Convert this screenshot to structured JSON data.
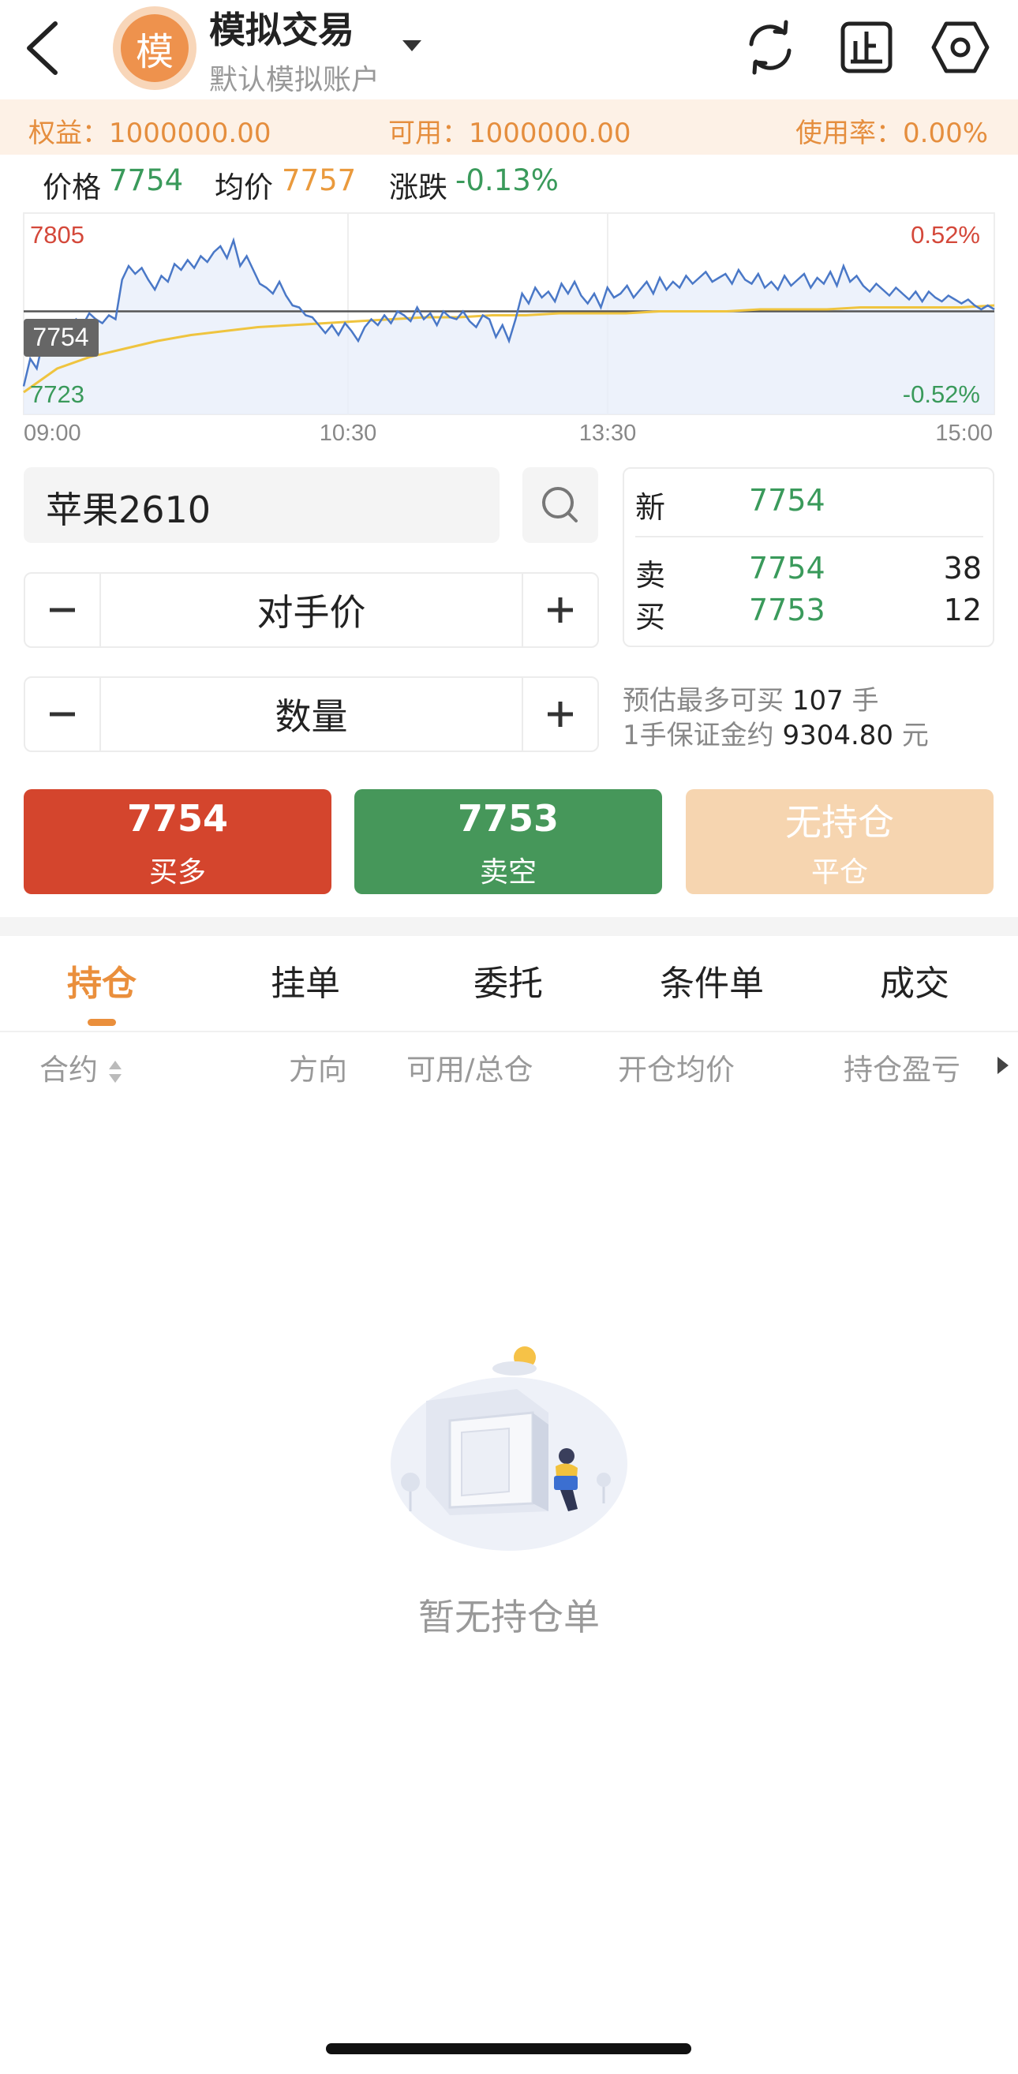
{
  "header": {
    "title": "模拟交易",
    "subtitle": "默认模拟账户",
    "avatar_char": "模",
    "icons": [
      "back-icon",
      "refresh-icon",
      "stop-order-icon",
      "settings-icon"
    ]
  },
  "account": {
    "equity_label": "权益：",
    "equity_value": "1000000.00",
    "available_label": "可用：",
    "available_value": "1000000.00",
    "usage_label": "使用率：",
    "usage_value": "0.00%"
  },
  "price_row": {
    "price_label": "价格",
    "price_value": "7754",
    "avg_label": "均价",
    "avg_value": "7757",
    "change_label": "涨跌",
    "change_value": "-0.13%"
  },
  "chart_data": {
    "type": "line",
    "y_top_label": "7805",
    "y_bottom_label": "7723",
    "pct_top_label": "0.52%",
    "pct_bottom_label": "-0.52%",
    "current_tag": "7754",
    "x_ticks": [
      "09:00",
      "10:30",
      "13:30",
      "15:00"
    ],
    "ylim": [
      7723,
      7805
    ],
    "baseline": 7764,
    "series": [
      {
        "values": [
          7726,
          7740,
          7735,
          7750,
          7745,
          7752,
          7748,
          7755,
          7760,
          7757,
          7763,
          7760,
          7758,
          7762,
          7760,
          7780,
          7787,
          7783,
          7786,
          7780,
          7775,
          7782,
          7779,
          7788,
          7785,
          7790,
          7786,
          7792,
          7789,
          7794,
          7797,
          7791,
          7800,
          7787,
          7792,
          7785,
          7778,
          7776,
          7773,
          7779,
          7772,
          7767,
          7766,
          7762,
          7761,
          7757,
          7753,
          7757,
          7752,
          7758,
          7754,
          7749,
          7756,
          7760,
          7757,
          7762,
          7758,
          7764,
          7762,
          7759,
          7766,
          7760,
          7763,
          7757,
          7764,
          7761,
          7760,
          7764,
          7759,
          7756,
          7762,
          7760,
          7751,
          7757,
          7749,
          7760,
          7773,
          7768,
          7776,
          7771,
          7774,
          7769,
          7778,
          7773,
          7779,
          7772,
          7768,
          7773,
          7766,
          7776,
          7771,
          7773,
          7777,
          7771,
          7775,
          7779,
          7773,
          7781,
          7775,
          7779,
          7776,
          7782,
          7778,
          7781,
          7784,
          7779,
          7781,
          7783,
          7778,
          7785,
          7780,
          7778,
          7783,
          7776,
          7779,
          7775,
          7782,
          7777,
          7780,
          7783,
          7776,
          7781,
          7778,
          7784,
          7777,
          7787,
          7779,
          7782,
          7777,
          7774,
          7778,
          7775,
          7772,
          7776,
          7773,
          7770,
          7774,
          7769,
          7774,
          7771,
          7769,
          7772,
          7770,
          7768,
          7770,
          7767,
          7765,
          7767,
          7765
        ]
      },
      {
        "name": "均价",
        "values": [
          7723,
          7735,
          7741,
          7745,
          7749,
          7752,
          7754,
          7756,
          7757,
          7758,
          7759,
          7760,
          7761,
          7761,
          7762,
          7762,
          7763,
          7763,
          7763,
          7764,
          7764,
          7764,
          7765,
          7765,
          7765,
          7766,
          7766,
          7766,
          7766,
          7767
        ]
      }
    ]
  },
  "order": {
    "contract": "苹果2610",
    "price_mode": "对手价",
    "quantity_label": "数量",
    "est_text": "预估最多可买",
    "est_count": "107",
    "est_unit": "手",
    "margin_text": "1手保证金约",
    "margin_value": "9304.80",
    "margin_unit": "元"
  },
  "quote": {
    "new_label": "新",
    "new_price": "7754",
    "ask_label": "卖",
    "ask_price": "7754",
    "ask_vol": "38",
    "bid_label": "买",
    "bid_price": "7753",
    "bid_vol": "12"
  },
  "actions": {
    "buy_price": "7754",
    "buy_label": "买多",
    "sell_price": "7753",
    "sell_label": "卖空",
    "close_status": "无持仓",
    "close_label": "平仓"
  },
  "tabs": [
    "持仓",
    "挂单",
    "委托",
    "条件单",
    "成交"
  ],
  "columns": [
    "合约",
    "方向",
    "可用/总仓",
    "开仓均价",
    "持仓盈亏"
  ],
  "empty_text": "暂无持仓单",
  "colors": {
    "accent": "#ea8f3c",
    "buy": "#d4452d",
    "sell": "#46975a",
    "close": "#f6d5b0",
    "line": "#4a78c7",
    "avg_line": "#efc43f"
  }
}
